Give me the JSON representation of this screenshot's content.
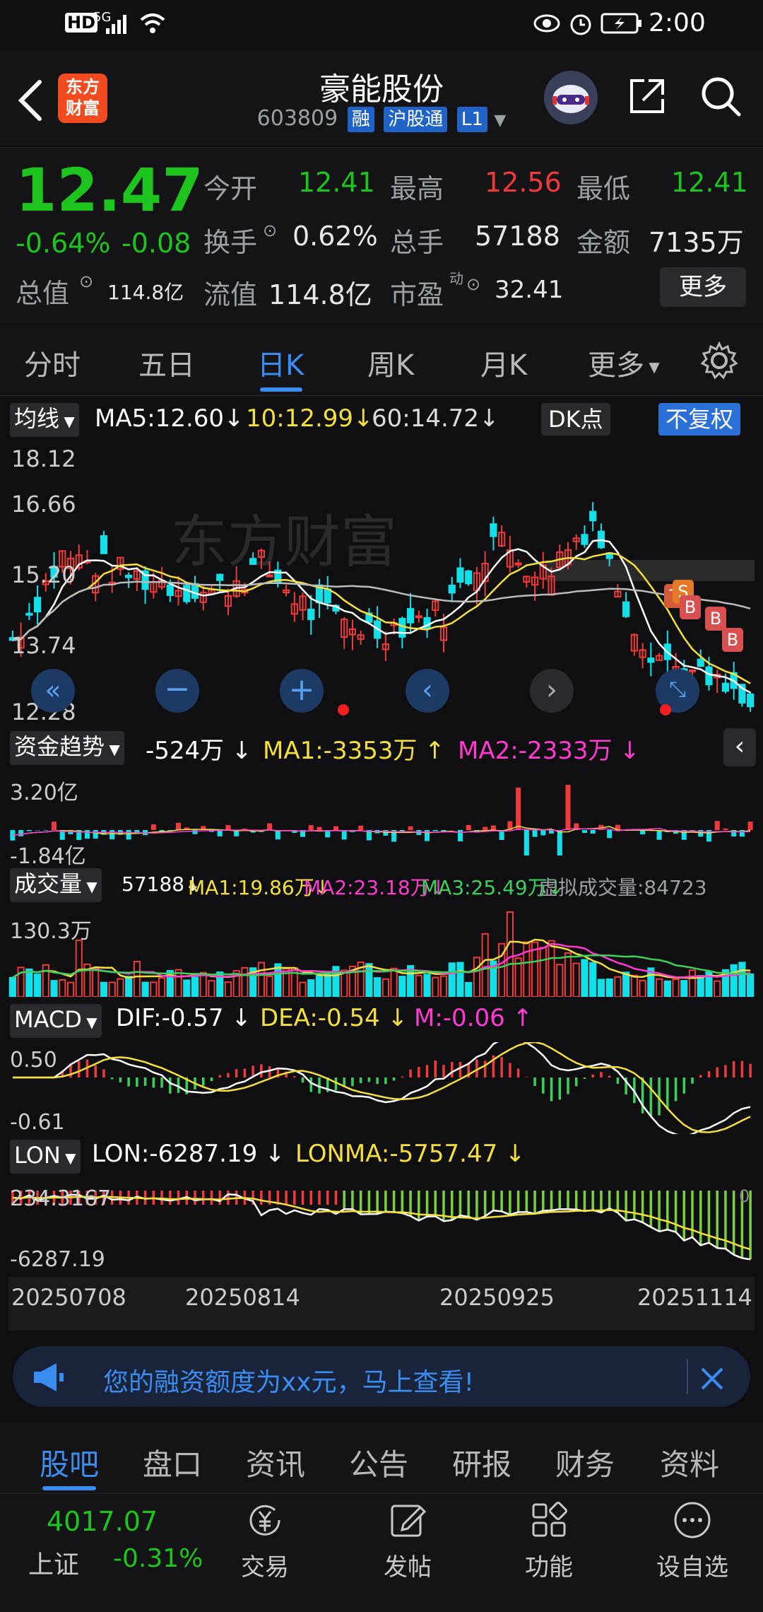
{
  "status": {
    "time": "2:00",
    "hd": "HD",
    "net": "5G"
  },
  "header": {
    "logo_line1": "东方",
    "logo_line2": "财富",
    "title": "豪能股份",
    "code": "603809",
    "tag1": "融",
    "tag2": "沪股通",
    "tag3": "L1"
  },
  "quote": {
    "price": "12.47",
    "pct": "-0.64%",
    "chg": "-0.08",
    "open_label": "今开",
    "open": "12.41",
    "high_label": "最高",
    "high": "12.56",
    "low_label": "最低",
    "low": "12.41",
    "turnover_label": "换手",
    "turnover": "0.62%",
    "vol_label": "总手",
    "vol": "57188",
    "amount_label": "金额",
    "amount": "7135万",
    "mcap_label": "总值",
    "mcap": "114.8亿",
    "float_label": "流值",
    "float": "114.8亿",
    "pe_label": "市盈",
    "pe_sup": "动",
    "pe": "32.41",
    "more": "更多"
  },
  "tabs": [
    "分时",
    "五日",
    "日K",
    "周K",
    "月K",
    "更多"
  ],
  "chart_data": {
    "type": "candlestick",
    "ma_label": "均线",
    "ma5": "MA5:12.60",
    "ma10": "10:12.99",
    "ma60": "60:14.72",
    "dk": "DK点",
    "fq": "不复权",
    "y_ticks": [
      "18.12",
      "16.66",
      "15.20",
      "13.74",
      "12.28"
    ],
    "x_ticks": [
      "20250708",
      "20250814",
      "20250925",
      "20251114"
    ],
    "signal_labels": [
      "T",
      "S",
      "B",
      "B",
      "B"
    ],
    "fund": {
      "name": "资金趋势",
      "val": "-524万",
      "ma1": "MA1:-3353万",
      "ma2": "MA2:-2333万",
      "top": "3.20亿",
      "bottom": "-1.84亿"
    },
    "volume": {
      "name": "成交量",
      "val": "57188",
      "ma1": "MA1:19.86万",
      "ma2": "MA2:23.18万",
      "ma3": "MA3:25.49万",
      "virtual": "虚拟成交量:84723",
      "top": "130.3万"
    },
    "macd": {
      "name": "MACD",
      "dif": "DIF:-0.57",
      "dea": "DEA:-0.54",
      "m": "M:-0.06",
      "top": "0.50",
      "bottom": "-0.61"
    },
    "lon": {
      "name": "LON",
      "lon": "LON:-6287.19",
      "lonma": "LONMA:-5757.47",
      "top": "234.3167",
      "bottom": "-6287.19",
      "zero": "0"
    }
  },
  "ad": {
    "text": "您的融资额度为xx元，马上查看!"
  },
  "sections": [
    "股吧",
    "盘口",
    "资讯",
    "公告",
    "研报",
    "财务",
    "资料"
  ],
  "bottom": {
    "index_val": "4017.07",
    "index_name": "上证",
    "index_pct": "-0.31%",
    "trade": "交易",
    "post": "发帖",
    "func": "功能",
    "watch": "设自选"
  },
  "colors": {
    "up": "#f03a3a",
    "down": "#1ec41e",
    "accent": "#3b8cf0",
    "cyan": "#12e0e8"
  }
}
